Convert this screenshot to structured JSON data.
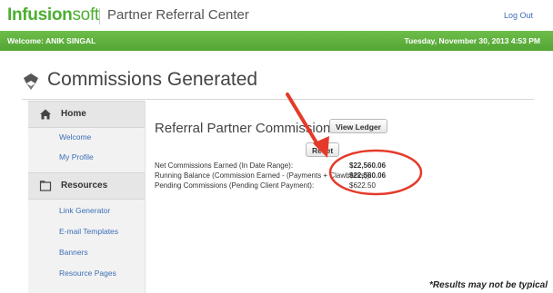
{
  "header": {
    "logo_part1": "Infusion",
    "logo_part2": "soft",
    "app_title": "Partner Referral Center",
    "logout_label": "Log Out"
  },
  "banner": {
    "welcome": "Welcome: ANIK SINGAL",
    "datetime": "Tuesday, November 30, 2013 4:53 PM"
  },
  "page": {
    "title": "Commissions Generated",
    "title_icon": "handshake-icon"
  },
  "sidebar": {
    "sections": [
      {
        "heading": "Home",
        "icon": "house-icon",
        "items": [
          "Welcome",
          "My Profile"
        ]
      },
      {
        "heading": "Resources",
        "icon": "folder-icon",
        "items": [
          "Link Generator",
          "E-mail Templates",
          "Banners",
          "Resource Pages"
        ]
      }
    ]
  },
  "main": {
    "section_title": "Referral Partner Commissions",
    "view_ledger_label": "View Ledger",
    "reset_label": "Reset",
    "rows": [
      {
        "label": "Net Commissions Earned (In Date Range):",
        "value": "$22,560.06"
      },
      {
        "label": "Running Balance (Commission Earned - (Payments + Clawbacks)):",
        "value": "$22,560.06"
      },
      {
        "label": "Pending Commissions (Pending Client Payment):",
        "value": "$622.50"
      }
    ]
  },
  "annotation": {
    "disclaimer": "*Results may not be typical",
    "color": "#e53a2a"
  },
  "colors": {
    "brand_green": "#4caf31",
    "link_blue": "#3b6fb6"
  }
}
